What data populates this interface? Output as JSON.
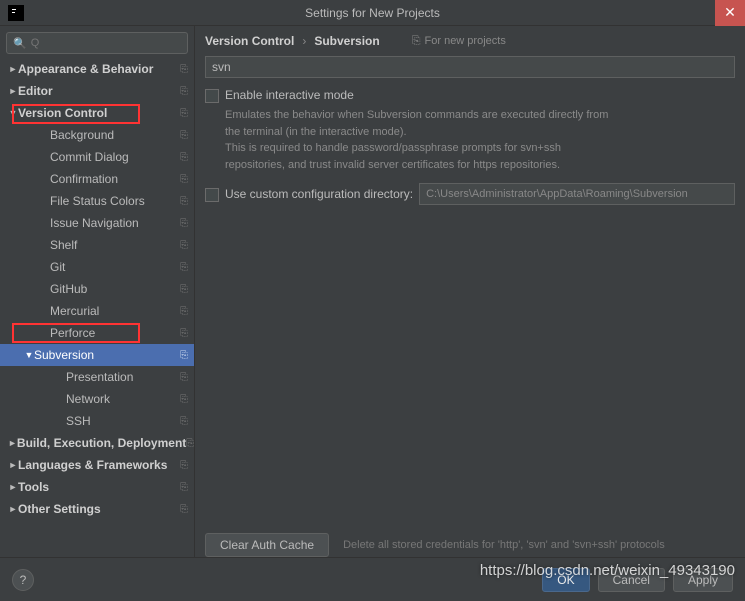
{
  "window": {
    "title": "Settings for New Projects"
  },
  "search": {
    "placeholder": "Q"
  },
  "sidebar": {
    "items": [
      {
        "label": "Appearance & Behavior",
        "arrow": "►",
        "bold": true,
        "indent": 0,
        "copy": true
      },
      {
        "label": "Editor",
        "arrow": "►",
        "bold": true,
        "indent": 0,
        "copy": true
      },
      {
        "label": "Version Control",
        "arrow": "▼",
        "bold": true,
        "indent": 0,
        "copy": true
      },
      {
        "label": "Background",
        "arrow": "",
        "bold": false,
        "indent": 2,
        "copy": true
      },
      {
        "label": "Commit Dialog",
        "arrow": "",
        "bold": false,
        "indent": 2,
        "copy": true
      },
      {
        "label": "Confirmation",
        "arrow": "",
        "bold": false,
        "indent": 2,
        "copy": true
      },
      {
        "label": "File Status Colors",
        "arrow": "",
        "bold": false,
        "indent": 2,
        "copy": true
      },
      {
        "label": "Issue Navigation",
        "arrow": "",
        "bold": false,
        "indent": 2,
        "copy": true
      },
      {
        "label": "Shelf",
        "arrow": "",
        "bold": false,
        "indent": 2,
        "copy": true
      },
      {
        "label": "Git",
        "arrow": "",
        "bold": false,
        "indent": 2,
        "copy": true
      },
      {
        "label": "GitHub",
        "arrow": "",
        "bold": false,
        "indent": 2,
        "copy": true
      },
      {
        "label": "Mercurial",
        "arrow": "",
        "bold": false,
        "indent": 2,
        "copy": true
      },
      {
        "label": "Perforce",
        "arrow": "",
        "bold": false,
        "indent": 2,
        "copy": true
      },
      {
        "label": "Subversion",
        "arrow": "▼",
        "bold": false,
        "indent": 1,
        "copy": true,
        "selected": true
      },
      {
        "label": "Presentation",
        "arrow": "",
        "bold": false,
        "indent": 3,
        "copy": true
      },
      {
        "label": "Network",
        "arrow": "",
        "bold": false,
        "indent": 3,
        "copy": true
      },
      {
        "label": "SSH",
        "arrow": "",
        "bold": false,
        "indent": 3,
        "copy": true
      },
      {
        "label": "Build, Execution, Deployment",
        "arrow": "►",
        "bold": true,
        "indent": 0,
        "copy": true
      },
      {
        "label": "Languages & Frameworks",
        "arrow": "►",
        "bold": true,
        "indent": 0,
        "copy": true
      },
      {
        "label": "Tools",
        "arrow": "►",
        "bold": true,
        "indent": 0,
        "copy": true
      },
      {
        "label": "Other Settings",
        "arrow": "►",
        "bold": true,
        "indent": 0,
        "copy": true
      }
    ]
  },
  "breadcrumb": {
    "a": "Version Control",
    "sep": "›",
    "b": "Subversion",
    "scope": "For new projects"
  },
  "panel": {
    "path_value": "svn",
    "check1_label": "Enable interactive mode",
    "desc1_line1": "Emulates the behavior when Subversion commands are executed directly from",
    "desc1_line2": "the terminal (in the interactive mode).",
    "desc1_line3": "This is required to handle password/passphrase prompts for svn+ssh",
    "desc1_line4": "repositories, and trust invalid server certificates for https repositories.",
    "check2_label": "Use custom configuration directory:",
    "config_dir": "C:\\Users\\Administrator\\AppData\\Roaming\\Subversion",
    "clear_btn": "Clear Auth Cache",
    "clear_hint": "Delete all stored credentials for 'http', 'svn' and 'svn+ssh' protocols"
  },
  "footer": {
    "ok": "OK",
    "cancel": "Cancel",
    "apply": "Apply"
  },
  "watermark": "https://blog.csdn.net/weixin_49343190"
}
